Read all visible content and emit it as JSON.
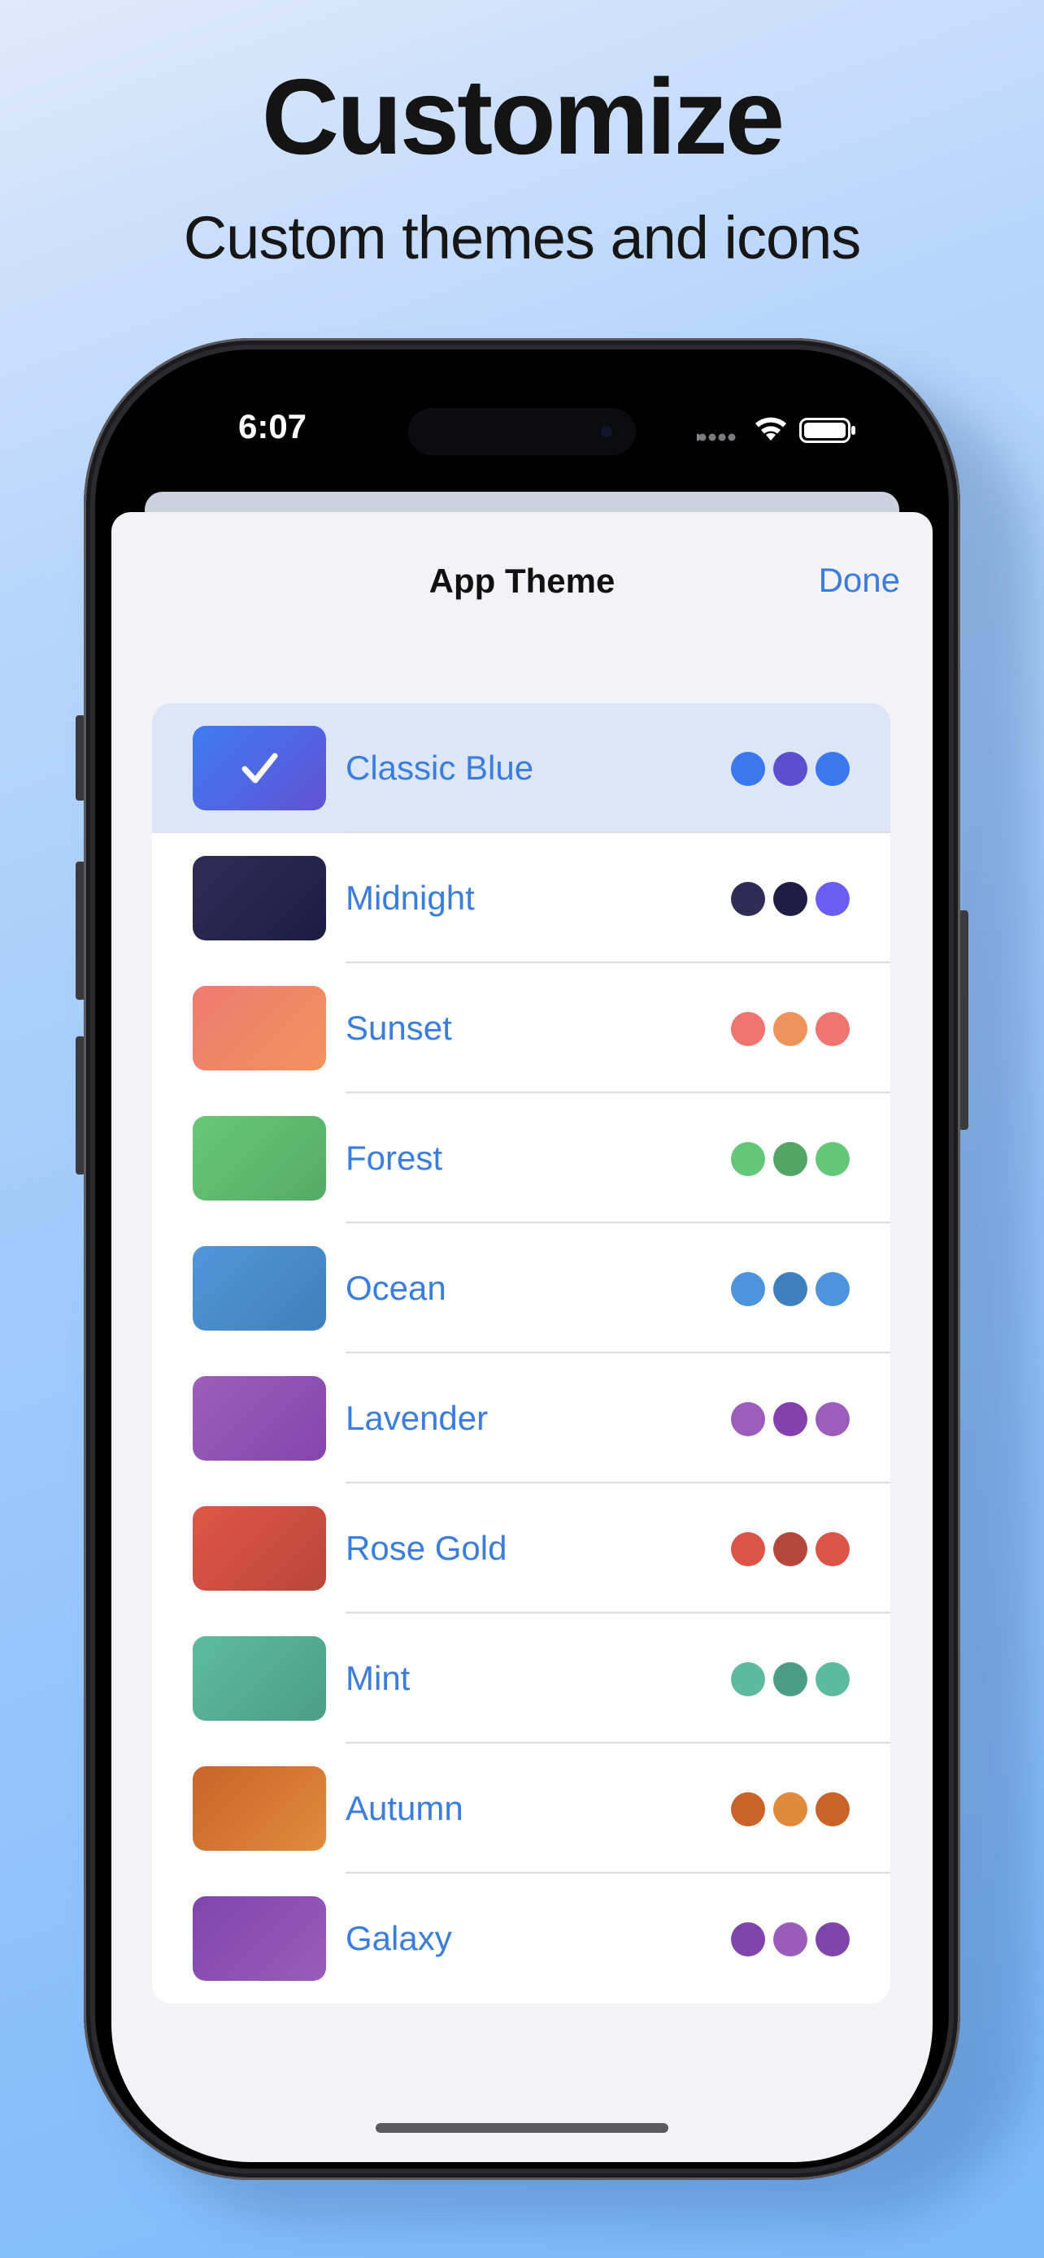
{
  "marketing": {
    "headline": "Customize",
    "subhead": "Custom themes and icons"
  },
  "status_bar": {
    "time": "6:07",
    "icons": [
      "cellular-icon",
      "wifi-icon",
      "battery-icon"
    ]
  },
  "nav": {
    "title": "App Theme",
    "done_label": "Done"
  },
  "themes": [
    {
      "name": "Classic Blue",
      "selected": true,
      "swatch": [
        "#3f7bf4",
        "#6052d2"
      ],
      "dots": [
        "#3b78f0",
        "#5b4fd0",
        "#3b78f0"
      ]
    },
    {
      "name": "Midnight",
      "selected": false,
      "swatch": [
        "#2f2d56",
        "#1d1c40"
      ],
      "dots": [
        "#2f2d56",
        "#1f1d44",
        "#6a5ef0"
      ]
    },
    {
      "name": "Sunset",
      "selected": false,
      "swatch": [
        "#ef7a70",
        "#f0935e"
      ],
      "dots": [
        "#ee7470",
        "#f0935a",
        "#ee7470"
      ]
    },
    {
      "name": "Forest",
      "selected": false,
      "swatch": [
        "#66c877",
        "#55aa66"
      ],
      "dots": [
        "#62c778",
        "#52a565",
        "#62c778"
      ]
    },
    {
      "name": "Ocean",
      "selected": false,
      "swatch": [
        "#5196da",
        "#3f7fbd"
      ],
      "dots": [
        "#4d94dc",
        "#3e7fbf",
        "#4d94dc"
      ]
    },
    {
      "name": "Lavender",
      "selected": false,
      "swatch": [
        "#9b5fba",
        "#8544ae"
      ],
      "dots": [
        "#9b5cbb",
        "#8340ae",
        "#9b5cbb"
      ]
    },
    {
      "name": "Rose Gold",
      "selected": false,
      "swatch": [
        "#df5646",
        "#b9463a"
      ],
      "dots": [
        "#dc5446",
        "#b4463b",
        "#dc5446"
      ]
    },
    {
      "name": "Mint",
      "selected": false,
      "swatch": [
        "#5cbc9e",
        "#4b9e83"
      ],
      "dots": [
        "#5bbb9c",
        "#4a9c82",
        "#5bbb9c"
      ]
    },
    {
      "name": "Autumn",
      "selected": false,
      "swatch": [
        "#c8632a",
        "#e08b3c"
      ],
      "dots": [
        "#c9632a",
        "#e08a3b",
        "#c9632a"
      ]
    },
    {
      "name": "Galaxy",
      "selected": false,
      "swatch": [
        "#7f45ad",
        "#9a5cba"
      ],
      "dots": [
        "#7f45ad",
        "#9b5bbb",
        "#7f45ad"
      ]
    }
  ]
}
